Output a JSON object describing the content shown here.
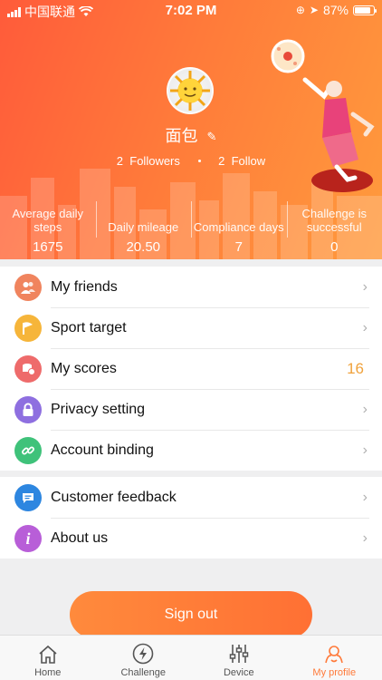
{
  "status_bar": {
    "carrier": "中国联通",
    "time": "7:02 PM",
    "battery": "87%"
  },
  "profile": {
    "username": "面包",
    "followers_count": "2",
    "followers_label": "Followers",
    "follow_count": "2",
    "follow_label": "Follow"
  },
  "stats": [
    {
      "label": "Average daily steps",
      "value": "1675"
    },
    {
      "label": "Daily mileage",
      "value": "20.50"
    },
    {
      "label": "Compliance days",
      "value": "7"
    },
    {
      "label": "Challenge is successful",
      "value": "0"
    }
  ],
  "menu1": [
    {
      "label": "My friends",
      "icon": "friends-icon",
      "color": "#f0845e"
    },
    {
      "label": "Sport target",
      "icon": "flag-icon",
      "color": "#f6b53a"
    },
    {
      "label": "My scores",
      "icon": "coins-icon",
      "color": "#ee6b6b",
      "value": "16"
    },
    {
      "label": "Privacy setting",
      "icon": "lock-icon",
      "color": "#8e6fe0"
    },
    {
      "label": "Account binding",
      "icon": "link-icon",
      "color": "#3fc27a"
    }
  ],
  "menu2": [
    {
      "label": "Customer feedback",
      "icon": "chat-icon",
      "color": "#2d86e0"
    },
    {
      "label": "About us",
      "icon": "info-icon",
      "color": "#b85ed8"
    }
  ],
  "sign_out": "Sign out",
  "tabs": [
    {
      "label": "Home",
      "icon": "home-icon"
    },
    {
      "label": "Challenge",
      "icon": "lightning-icon"
    },
    {
      "label": "Device",
      "icon": "sliders-icon"
    },
    {
      "label": "My profile",
      "icon": "profile-icon",
      "active": true
    }
  ]
}
